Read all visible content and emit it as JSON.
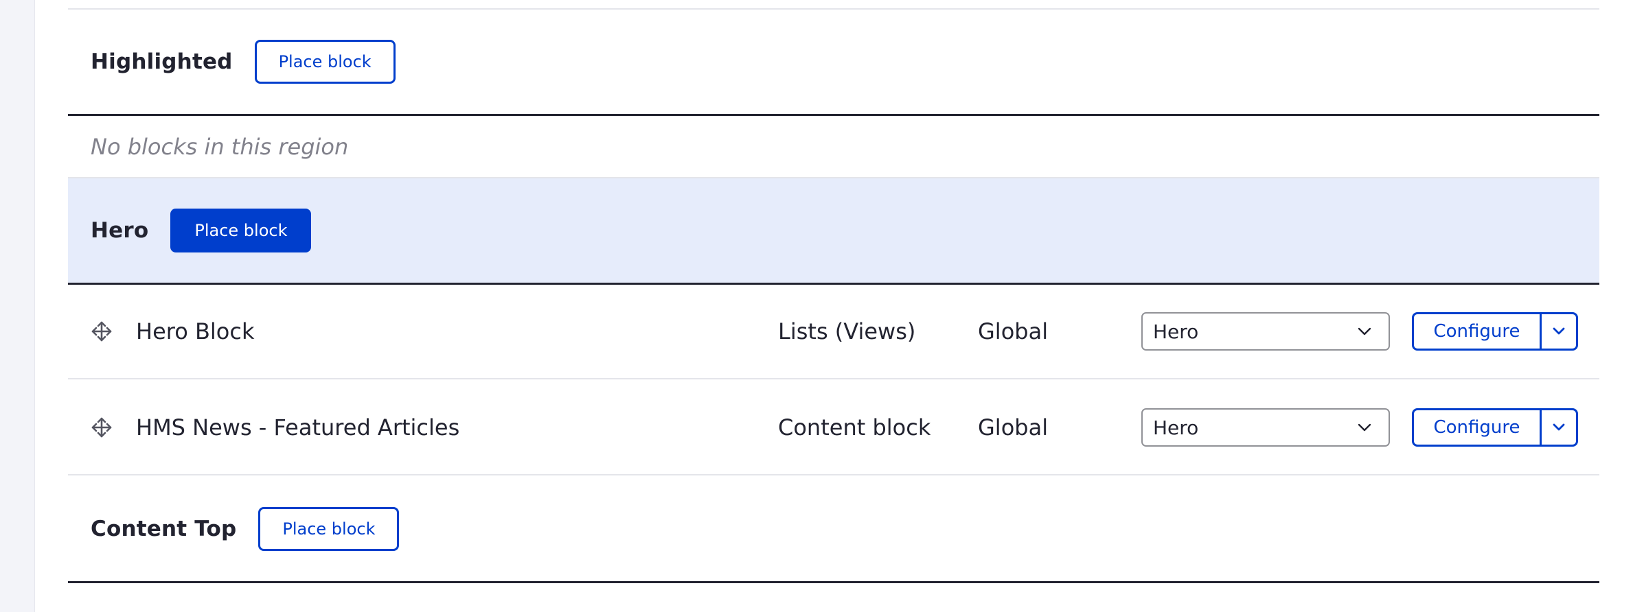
{
  "regions": [
    {
      "title": "Highlighted",
      "place_label": "Place block",
      "empty_text": "No blocks in this region"
    },
    {
      "title": "Hero",
      "place_label": "Place block"
    },
    {
      "title": "Content Top",
      "place_label": "Place block"
    }
  ],
  "hero_blocks": [
    {
      "name": "Hero Block",
      "category": "Lists (Views)",
      "context": "Global",
      "region": "Hero",
      "configure_label": "Configure"
    },
    {
      "name": "HMS News - Featured Articles",
      "category": "Content block",
      "context": "Global",
      "region": "Hero",
      "configure_label": "Configure"
    }
  ],
  "colors": {
    "accent": "#003ecc",
    "hero_highlight": "#e6ecfb",
    "text": "#222330",
    "muted": "#82828c"
  },
  "icons": {
    "drag": "move-arrows-icon",
    "dropdown": "chevron-down-icon"
  }
}
